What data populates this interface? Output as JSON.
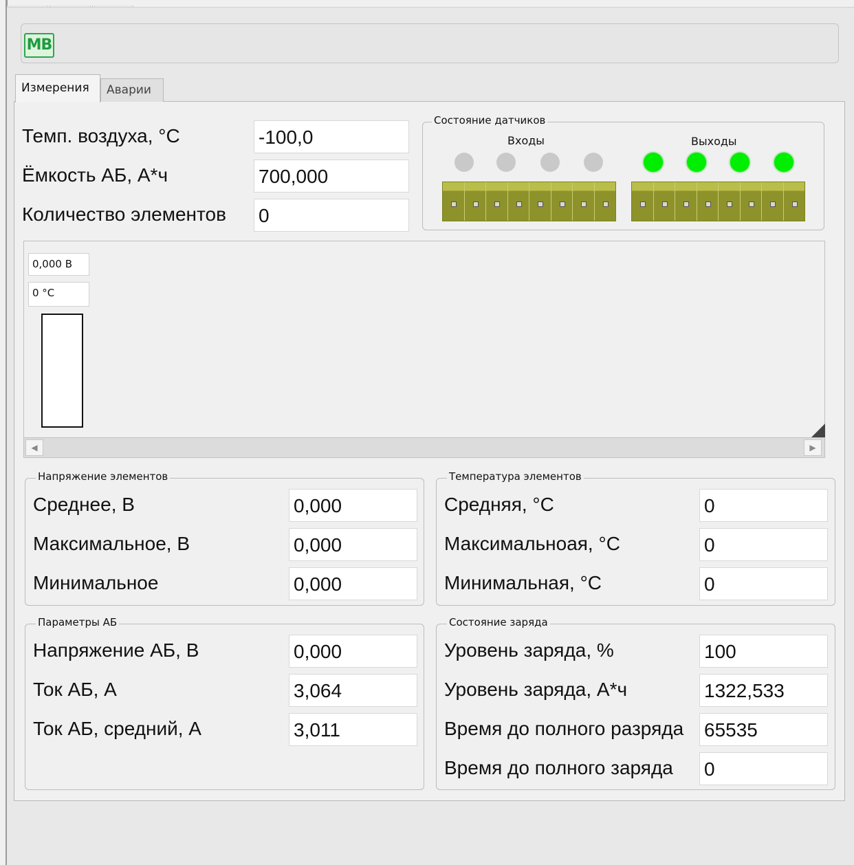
{
  "logo": {
    "text": "MB"
  },
  "tabs": [
    {
      "label": "Измерения",
      "active": true
    },
    {
      "label": "Аварии",
      "active": false
    }
  ],
  "general": {
    "air_temp_label": "Темп. воздуха, °C",
    "air_temp_value": "-100,0",
    "capacity_label": "Ёмкость АБ, А*ч",
    "capacity_value": "700,000",
    "cell_count_label": "Количество элементов",
    "cell_count_value": "0"
  },
  "sensors": {
    "title": "Состояние датчиков",
    "inputs_label": "Входы",
    "outputs_label": "Выходы",
    "inputs_state": [
      "off",
      "off",
      "off",
      "off"
    ],
    "outputs_state": [
      "on",
      "on",
      "on",
      "on"
    ],
    "colors": {
      "led_on": "#00ee00",
      "led_off": "#c9c9c9",
      "connector": "#a6ac3a"
    }
  },
  "cell_chart": {
    "voltage": "0,000 В",
    "temperature": "0 °C"
  },
  "cell_voltage": {
    "title": "Напряжение элементов",
    "rows": [
      {
        "label": "Среднее, В",
        "value": "0,000"
      },
      {
        "label": "Максимальное, В",
        "value": "0,000"
      },
      {
        "label": "Минимальное",
        "value": "0,000"
      }
    ]
  },
  "cell_temperature": {
    "title": "Температура элементов",
    "rows": [
      {
        "label": "Средняя, °C",
        "value": "0"
      },
      {
        "label": "Максимальноая, °C",
        "value": "0"
      },
      {
        "label": "Минимальная, °C",
        "value": "0"
      }
    ]
  },
  "battery_params": {
    "title": "Параметры АБ",
    "rows": [
      {
        "label": "Напряжение АБ, В",
        "value": "0,000"
      },
      {
        "label": "Ток АБ, А",
        "value": "3,064"
      },
      {
        "label": "Ток АБ, средний, А",
        "value": "3,011"
      }
    ]
  },
  "charge_state": {
    "title": "Состояние заряда",
    "rows": [
      {
        "label": "Уровень заряда, %",
        "value": "100"
      },
      {
        "label": "Уровень заряда, А*ч",
        "value": "1322,533"
      },
      {
        "label": "Время до полного разряда",
        "value": "65535"
      },
      {
        "label": "Время до полного заряда",
        "value": "0"
      }
    ]
  }
}
